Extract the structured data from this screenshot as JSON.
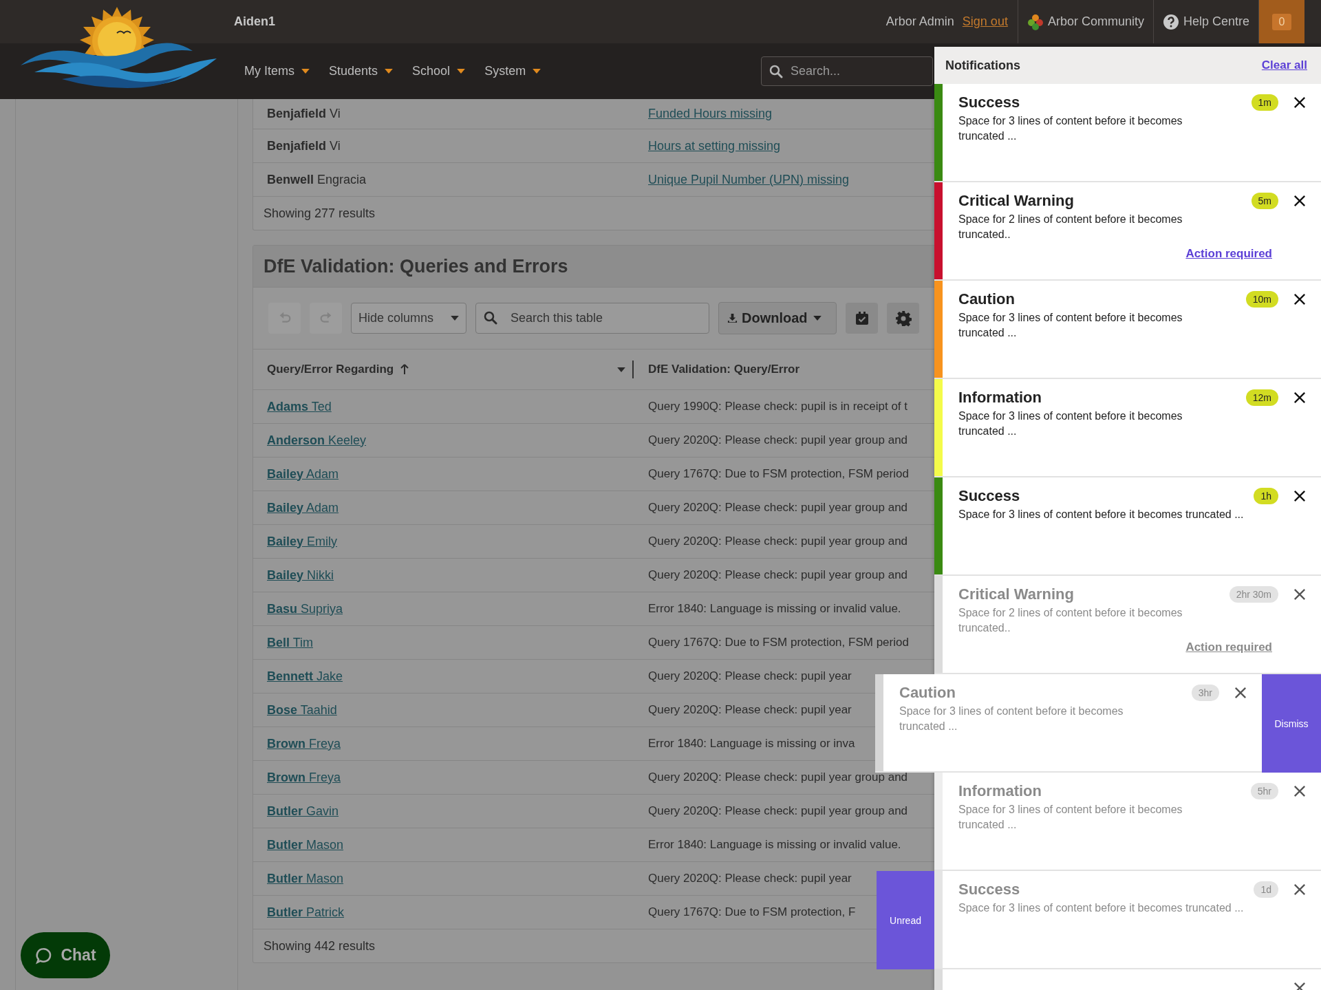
{
  "header": {
    "school": "Aiden1",
    "user": "Arbor Admin",
    "sign_out": "Sign out",
    "links": [
      {
        "label": "Arbor Community",
        "kind": "community"
      },
      {
        "label": "Help Centre",
        "kind": "help"
      }
    ],
    "notification_count": "0"
  },
  "nav": {
    "items": [
      {
        "label": "My Items"
      },
      {
        "label": "Students"
      },
      {
        "label": "School"
      },
      {
        "label": "System"
      }
    ],
    "search": {
      "placeholder": "Search..."
    }
  },
  "top_table": {
    "rows": [
      {
        "name": "**Benjafield** Vi",
        "issue": "Funded Hours missing"
      },
      {
        "name": "**Benjafield** Vi",
        "issue": "Hours at setting missing"
      },
      {
        "name": "**Benwell** Engracia",
        "issue": "Unique Pupil Number (UPN) missing"
      }
    ],
    "footer": "Showing 277 results"
  },
  "section": {
    "title": "DfE Validation: Queries and Errors",
    "toolbar": {
      "undo": {
        "disabled": true
      },
      "redo": {
        "disabled": true
      },
      "hide_columns": "Hide columns",
      "search": {
        "placeholder": "Search this table"
      },
      "download": "Download"
    },
    "columns": [
      {
        "label": "Query/Error Regarding",
        "sorted": true
      },
      {
        "label": "DfE Validation: Query/Error"
      }
    ],
    "rows": [
      {
        "student": "**Adams** Ted",
        "query": "Query 1990Q: Please check: pupil is in receipt of t"
      },
      {
        "student": "**Anderson** Keeley",
        "query": "Query 2020Q: Please check: pupil year group and"
      },
      {
        "student": "**Bailey** Adam",
        "query": "Query 1767Q: Due to FSM protection, FSM period"
      },
      {
        "student": "**Bailey** Adam",
        "query": "Query 2020Q: Please check: pupil year group and"
      },
      {
        "student": "**Bailey** Emily",
        "query": "Query 2020Q: Please check: pupil year group and"
      },
      {
        "student": "**Bailey** Nikki",
        "query": "Query 2020Q: Please check: pupil year group and"
      },
      {
        "student": "**Basu** Supriya",
        "query": "Error 1840: Language is missing or invalid value."
      },
      {
        "student": "**Bell** Tim",
        "query": "Query 1767Q: Due to FSM protection, FSM period"
      },
      {
        "student": "**Bennett** Jake",
        "query": "Query 2020Q: Please check: pupil year"
      },
      {
        "student": "**Bose** Taahid",
        "query": "Query 2020Q: Please check: pupil year"
      },
      {
        "student": "**Brown** Freya",
        "query": "Error 1840: Language is missing or inva"
      },
      {
        "student": "**Brown** Freya",
        "query": "Query 2020Q: Please check: pupil year group and"
      },
      {
        "student": "**Butler** Gavin",
        "query": "Query 2020Q: Please check: pupil year group and"
      },
      {
        "student": "**Butler** Mason",
        "query": "Error 1840: Language is missing or invalid value."
      },
      {
        "student": "**Butler** Mason",
        "query": "Query 2020Q: Please check: pupil year"
      },
      {
        "student": "**Butler** Patrick",
        "query": "Query 1767Q: Due to FSM protection, F"
      }
    ],
    "footer": "Showing 442 results"
  },
  "chat": {
    "label": "Chat"
  },
  "notifications": {
    "title": "Notifications",
    "clear_all": "Clear all",
    "items": [
      {
        "kind": "plain",
        "title": "Success",
        "text": "Space for 3 lines of content before it becomes truncated ...",
        "time": "1m",
        "read": false,
        "color": "#3a8a12",
        "wide": false
      },
      {
        "kind": "plain",
        "title": "Critical Warning",
        "text": "Space for 2 lines of content before it becomes truncated..",
        "time": "5m",
        "read": false,
        "color": "#c8102e",
        "wide": false,
        "action": "Action required"
      },
      {
        "kind": "plain",
        "title": "Caution",
        "text": "Space for 3 lines of content before it becomes truncated ...",
        "time": "10m",
        "read": false,
        "color": "#f7931e",
        "wide": false
      },
      {
        "kind": "plain",
        "title": "Information",
        "text": "Space for 3 lines of content before it becomes truncated ...",
        "time": "12m",
        "read": false,
        "color": "#f4fb4a",
        "wide": false
      },
      {
        "kind": "plain",
        "title": "Success",
        "text": "Space for 3 lines of content before it becomes truncated ...",
        "time": "1h",
        "read": false,
        "color": "#3a8a12",
        "wide": true
      },
      {
        "kind": "plain",
        "title": "Critical Warning",
        "text": "Space for 2 lines of content before it becomes truncated..",
        "time": "2hr 30m",
        "read": true,
        "color": "#dcdcdc",
        "wide": false,
        "action": "Action required"
      },
      {
        "kind": "swiped_left",
        "title": "Caution",
        "text": "Space for 3 lines of content before it becomes truncated ...",
        "time": "3hr",
        "read": true,
        "color": "#d6d6d6",
        "wide": false,
        "swipe_action": "Dismiss"
      },
      {
        "kind": "plain",
        "title": "Information",
        "text": "Space for 3 lines of content before it becomes truncated ...",
        "time": "5hr",
        "read": true,
        "color": "#eeeeee",
        "wide": false
      },
      {
        "kind": "swiped_right",
        "title": "Success",
        "text": "Space for 3 lines of content before it becomes truncated ...",
        "time": "1d",
        "read": true,
        "color": "#e4e4e4",
        "wide": true,
        "swipe_action": "Unread"
      },
      {
        "kind": "plain",
        "read": true,
        "color": "#dcdcdc"
      }
    ]
  }
}
